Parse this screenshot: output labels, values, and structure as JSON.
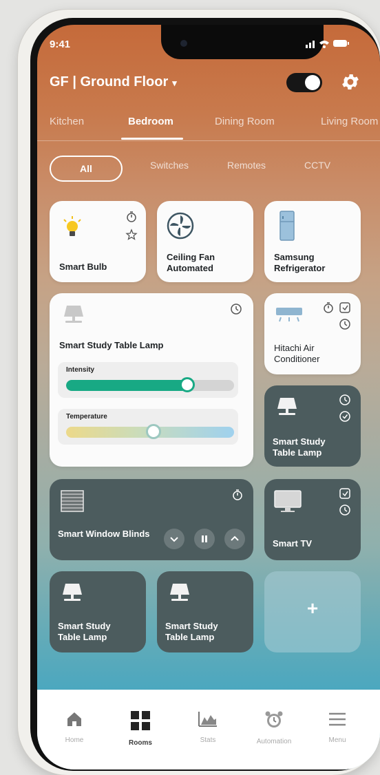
{
  "status_bar": {
    "time": "9:41",
    "indicators": "signal-wifi-battery-icons"
  },
  "header": {
    "floor_title": "GF | Ground Floor",
    "dropdown_icon": "chevron-down-icon",
    "toggle_state": "on",
    "settings_icon": "gear-icon"
  },
  "rooms": {
    "tabs": [
      "Kitchen",
      "Bedroom",
      "Dining Room",
      "Living Room"
    ],
    "active": "Bedroom"
  },
  "filters": {
    "chips": [
      "All",
      "Switches",
      "Remotes",
      "CCTV"
    ],
    "active": "All"
  },
  "devices": {
    "smart_bulb": {
      "name": "Smart Bulb",
      "icon": "lightbulb-icon",
      "actions": [
        "timer-icon",
        "star-icon"
      ]
    },
    "ceiling_fan": {
      "name": "Ceiling Fan Automated",
      "icon": "fan-icon"
    },
    "refrigerator": {
      "name": "Samsung Refrigerator",
      "icon": "refrigerator-icon"
    },
    "study_lamp_main": {
      "name": "Smart Study Table Lamp",
      "icon": "table-lamp-icon",
      "actions": [
        "timer-icon"
      ],
      "intensity_label": "Intensity",
      "intensity_level": 0.72,
      "temperature_label": "Temperature",
      "temperature_level": 0.52
    },
    "air_conditioner": {
      "name": "Hitachi Air Conditioner",
      "icon": "air-conditioner-icon",
      "actions": [
        "timer-icon",
        "schedule-icon",
        "clock-icon"
      ]
    },
    "study_lamp_right": {
      "name": "Smart Study Table Lamp",
      "icon": "table-lamp-icon",
      "actions": [
        "clock-icon",
        "check-icon"
      ]
    },
    "window_blinds": {
      "name": "Smart Window Blinds",
      "icon": "window-blinds-icon",
      "actions": [
        "timer-icon"
      ],
      "controls": [
        "chevron-down-icon",
        "pause-icon",
        "chevron-up-icon"
      ]
    },
    "smart_tv": {
      "name": "Smart TV",
      "icon": "tv-icon",
      "actions": [
        "schedule-icon",
        "clock-icon"
      ]
    },
    "study_lamp_bottom_1": {
      "name": "Smart Study Table Lamp",
      "icon": "table-lamp-icon"
    },
    "study_lamp_bottom_2": {
      "name": "Smart Study Table Lamp",
      "icon": "table-lamp-icon"
    },
    "add_device": {
      "label": "+"
    }
  },
  "bottom_nav": {
    "items": [
      {
        "label": "Home",
        "icon": "home-icon"
      },
      {
        "label": "Rooms",
        "icon": "grid-icon"
      },
      {
        "label": "Stats",
        "icon": "stats-icon"
      },
      {
        "label": "Automation",
        "icon": "alarm-clock-icon"
      },
      {
        "label": "Menu",
        "icon": "menu-icon"
      }
    ],
    "active": "Rooms"
  },
  "colors": {
    "accent_green": "#18a984",
    "header_orange": "#c56a3a",
    "dark_card": "#4c5c5e",
    "nav_background": "#ffffff"
  }
}
